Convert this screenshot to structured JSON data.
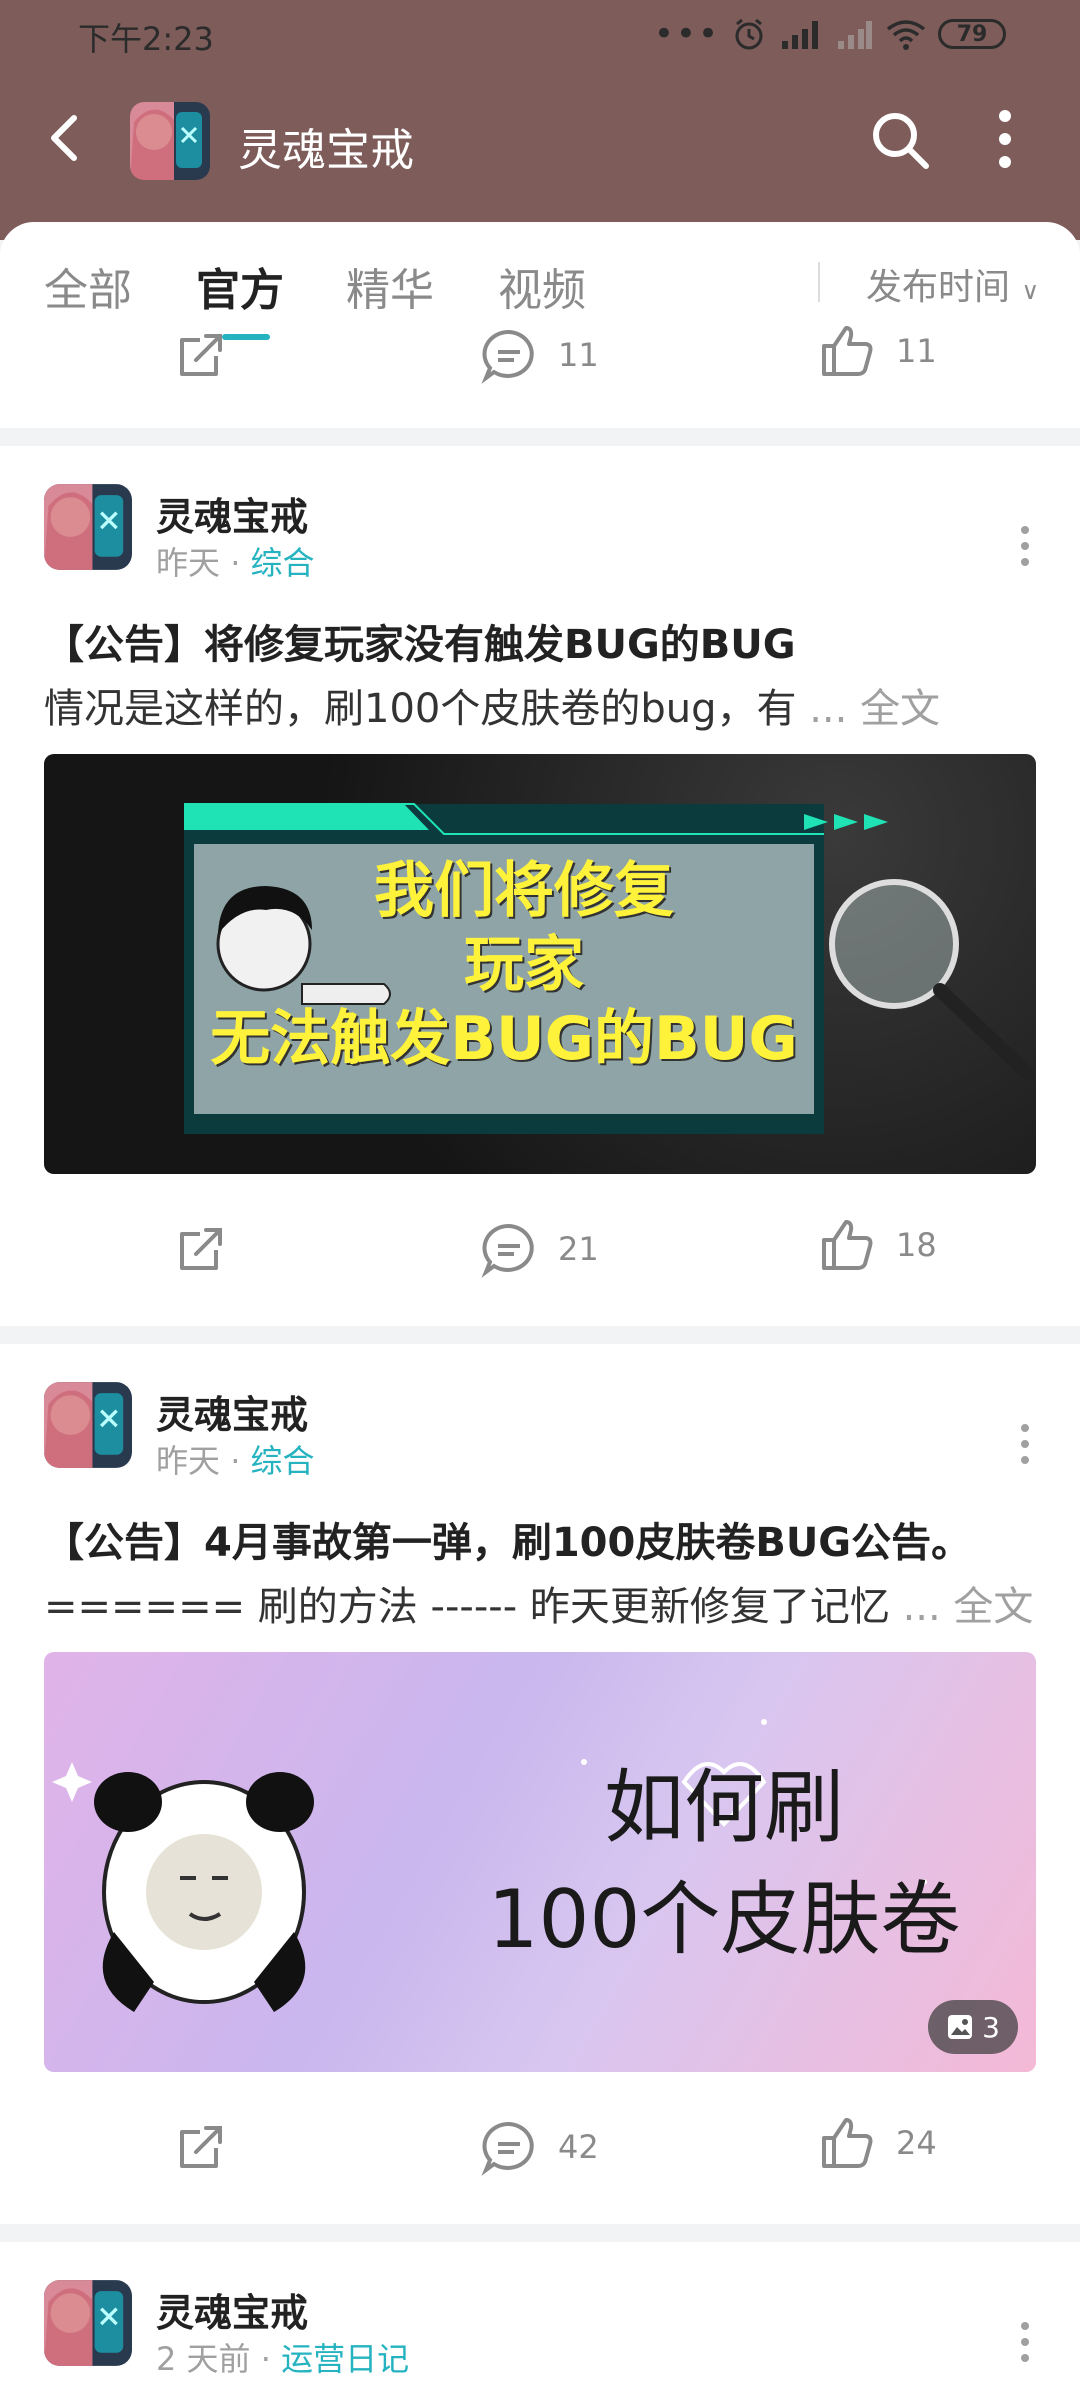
{
  "status": {
    "time": "下午2:23",
    "battery": "79"
  },
  "titlebar": {
    "title": "灵魂宝戒"
  },
  "tabs": [
    {
      "label": "全部",
      "active": false
    },
    {
      "label": "官方",
      "active": true
    },
    {
      "label": "精华",
      "active": false
    },
    {
      "label": "视频",
      "active": false
    }
  ],
  "sort_label": "发布时间",
  "partial_post": {
    "comments": "11",
    "likes": "11"
  },
  "posts": [
    {
      "author": "灵魂宝戒",
      "time": "昨天",
      "category": "综合",
      "title": "【公告】将修复玩家没有触发BUG的BUG",
      "excerpt": "情况是这样的，刷100个皮肤卷的bug，有",
      "full_label": "... 全文",
      "image_lines": [
        "我们将修复",
        "玩家",
        "无法触发BUG的BUG"
      ],
      "comments": "21",
      "likes": "18"
    },
    {
      "author": "灵魂宝戒",
      "time": "昨天",
      "category": "综合",
      "title": "【公告】4月事故第一弹，刷100皮肤卷BUG公告。",
      "excerpt": "====== 刷的方法 ------ 昨天更新修复了记忆",
      "full_label": "... 全文",
      "image_lines": [
        "如何刷",
        "100个皮肤卷"
      ],
      "image_count": "3",
      "comments": "42",
      "likes": "24"
    },
    {
      "author": "灵魂宝戒",
      "time": "2 天前",
      "category": "运营日记"
    }
  ],
  "colors": {
    "header": "#7d5c5a",
    "accent": "#26b3c0"
  }
}
